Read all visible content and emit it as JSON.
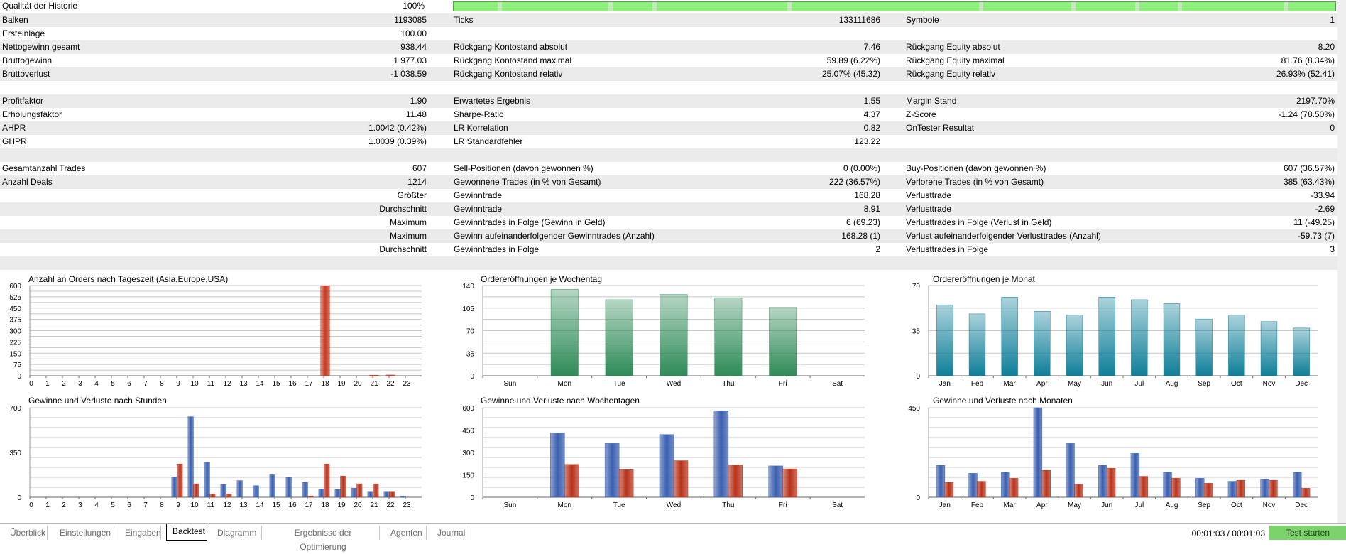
{
  "history_quality": {
    "label": "Qualität der Historie",
    "value": "100%"
  },
  "stats_rows": [
    {
      "l1": "Balken",
      "v1": "1193085",
      "l2": "Ticks",
      "v2": "133111686",
      "l3": "Symbole",
      "v3": "1",
      "alt": true
    },
    {
      "l1": "Ersteinlage",
      "v1": "100.00",
      "l2": "",
      "v2": "",
      "l3": "",
      "v3": "",
      "alt": false
    },
    {
      "l1": "Nettogewinn gesamt",
      "v1": "938.44",
      "l2": "Rückgang Kontostand absolut",
      "v2": "7.46",
      "l3": "Rückgang Equity absolut",
      "v3": "8.20",
      "alt": true
    },
    {
      "l1": "Bruttogewinn",
      "v1": "1 977.03",
      "l2": "Rückgang Kontostand maximal",
      "v2": "59.89 (6.22%)",
      "l3": "Rückgang Equity maximal",
      "v3": "81.76 (8.34%)",
      "alt": false
    },
    {
      "l1": "Bruttoverlust",
      "v1": "-1 038.59",
      "l2": "Rückgang Kontostand relativ",
      "v2": "25.07% (45.32)",
      "l3": "Rückgang Equity relativ",
      "v3": "26.93% (52.41)",
      "alt": true
    },
    {
      "l1": "",
      "v1": "",
      "l2": "",
      "v2": "",
      "l3": "",
      "v3": "",
      "alt": false
    },
    {
      "l1": "Profitfaktor",
      "v1": "1.90",
      "l2": "Erwartetes Ergebnis",
      "v2": "1.55",
      "l3": "Margin Stand",
      "v3": "2197.70%",
      "alt": true
    },
    {
      "l1": "Erholungsfaktor",
      "v1": "11.48",
      "l2": "Sharpe-Ratio",
      "v2": "4.37",
      "l3": "Z-Score",
      "v3": "-1.24 (78.50%)",
      "alt": false
    },
    {
      "l1": "AHPR",
      "v1": "1.0042 (0.42%)",
      "l2": "LR Korrelation",
      "v2": "0.82",
      "l3": "OnTester Resultat",
      "v3": "0",
      "alt": true
    },
    {
      "l1": "GHPR",
      "v1": "1.0039 (0.39%)",
      "l2": "LR Standardfehler",
      "v2": "123.22",
      "l3": "",
      "v3": "",
      "alt": false
    },
    {
      "l1": "",
      "v1": "",
      "l2": "",
      "v2": "",
      "l3": "",
      "v3": "",
      "alt": true
    },
    {
      "l1": "Gesamtanzahl Trades",
      "v1": "607",
      "l2": "Sell-Positionen (davon gewonnen %)",
      "v2": "0 (0.00%)",
      "l3": "Buy-Positionen (davon gewonnen %)",
      "v3": "607 (36.57%)",
      "alt": false
    },
    {
      "l1": "Anzahl Deals",
      "v1": "1214",
      "l2": "Gewonnene Trades (in % von Gesamt)",
      "v2": "222 (36.57%)",
      "l3": "Verlorene Trades (in % von Gesamt)",
      "v3": "385 (63.43%)",
      "alt": true
    },
    {
      "l1": "",
      "v1": "Größter",
      "l2": "Gewinntrade",
      "v2": "168.28",
      "l3": "Verlusttrade",
      "v3": "-33.94",
      "alt": false
    },
    {
      "l1": "",
      "v1": "Durchschnitt",
      "l2": "Gewinntrade",
      "v2": "8.91",
      "l3": "Verlusttrade",
      "v3": "-2.69",
      "alt": true
    },
    {
      "l1": "",
      "v1": "Maximum",
      "l2": "Gewinntrades in Folge (Gewinn in Geld)",
      "v2": "6 (69.23)",
      "l3": "Verlusttrades in Folge (Verlust in Geld)",
      "v3": "11 (-49.25)",
      "alt": false
    },
    {
      "l1": "",
      "v1": "Maximum",
      "l2": "Gewinn aufeinanderfolgender Gewinntrades (Anzahl)",
      "v2": "168.28 (1)",
      "l3": "Verlust aufeinanderfolgender Verlusttrades (Anzahl)",
      "v3": "-59.73 (7)",
      "alt": true
    },
    {
      "l1": "",
      "v1": "Durchschnitt",
      "l2": "Gewinntrades in Folge",
      "v2": "2",
      "l3": "Verlusttrades in Folge",
      "v3": "3",
      "alt": false
    },
    {
      "l1": "",
      "v1": "",
      "l2": "",
      "v2": "",
      "l3": "",
      "v3": "",
      "alt": true
    }
  ],
  "chart_data": [
    {
      "id": "orders_by_hour",
      "type": "bar",
      "title": "Anzahl an Orders nach Tageszeit (Asia,Europe,USA)",
      "categories": [
        "0",
        "1",
        "2",
        "3",
        "4",
        "5",
        "6",
        "7",
        "8",
        "9",
        "10",
        "11",
        "12",
        "13",
        "14",
        "15",
        "16",
        "17",
        "18",
        "19",
        "20",
        "21",
        "22",
        "23"
      ],
      "values": [
        0,
        0,
        0,
        0,
        0,
        0,
        0,
        0,
        0,
        0,
        0,
        0,
        0,
        0,
        0,
        0,
        0,
        0,
        598,
        0,
        0,
        4,
        5,
        0
      ],
      "yticks": [
        0,
        75,
        150,
        225,
        300,
        375,
        450,
        525,
        600
      ],
      "ylim": [
        0,
        600
      ],
      "color": "#c83a1e"
    },
    {
      "id": "orders_by_weekday",
      "type": "bar",
      "title": "Ordereröffnungen je Wochentag",
      "categories": [
        "Sun",
        "Mon",
        "Tue",
        "Wed",
        "Thu",
        "Fri",
        "Sat"
      ],
      "values": [
        0,
        134,
        118,
        126,
        121,
        106,
        0
      ],
      "yticks": [
        0,
        35,
        70,
        105,
        140
      ],
      "ylim": [
        0,
        140
      ],
      "color": "#2e8b57"
    },
    {
      "id": "orders_by_month",
      "type": "bar",
      "title": "Ordereröffnungen je Monat",
      "categories": [
        "Jan",
        "Feb",
        "Mar",
        "Apr",
        "May",
        "Jun",
        "Jul",
        "Aug",
        "Sep",
        "Oct",
        "Nov",
        "Dec"
      ],
      "values": [
        55,
        48,
        61,
        50,
        47,
        61,
        59,
        56,
        44,
        47,
        42,
        37
      ],
      "yticks": [
        0,
        35,
        70
      ],
      "ylim": [
        0,
        70
      ],
      "color": "#0f7f99"
    },
    {
      "id": "pl_by_hour",
      "type": "bar",
      "title": "Gewinne und Verluste nach Stunden",
      "categories": [
        "0",
        "1",
        "2",
        "3",
        "4",
        "5",
        "6",
        "7",
        "8",
        "9",
        "10",
        "11",
        "12",
        "13",
        "14",
        "15",
        "16",
        "17",
        "18",
        "19",
        "20",
        "21",
        "22",
        "23"
      ],
      "series": [
        {
          "values": [
            0,
            0,
            0,
            0,
            0,
            0,
            0,
            0,
            0,
            160,
            630,
            275,
            100,
            130,
            90,
            175,
            155,
            115,
            65,
            60,
            70,
            40,
            40,
            10
          ],
          "color": "#3a5fb0"
        },
        {
          "values": [
            0,
            0,
            0,
            0,
            0,
            0,
            0,
            0,
            0,
            260,
            105,
            25,
            25,
            0,
            0,
            0,
            0,
            10,
            260,
            165,
            105,
            105,
            40,
            0
          ],
          "color": "#b8321a"
        }
      ],
      "yticks": [
        0,
        350,
        700
      ],
      "ylim": [
        0,
        700
      ]
    },
    {
      "id": "pl_by_weekday",
      "type": "bar",
      "title": "Gewinne und Verluste nach Wochentagen",
      "categories": [
        "Sun",
        "Mon",
        "Tue",
        "Wed",
        "Thu",
        "Fri",
        "Sat"
      ],
      "series": [
        {
          "values": [
            0,
            430,
            360,
            420,
            580,
            210,
            0
          ],
          "color": "#3a5fb0"
        },
        {
          "values": [
            0,
            220,
            185,
            245,
            215,
            190,
            0
          ],
          "color": "#b8321a"
        }
      ],
      "yticks": [
        0,
        150,
        300,
        450,
        600
      ],
      "ylim": [
        0,
        600
      ]
    },
    {
      "id": "pl_by_month",
      "type": "bar",
      "title": "Gewinne und Verluste nach Monaten",
      "categories": [
        "Jan",
        "Feb",
        "Mar",
        "Apr",
        "May",
        "Jun",
        "Jul",
        "Aug",
        "Sep",
        "Oct",
        "Nov",
        "Dec"
      ],
      "series": [
        {
          "values": [
            160,
            120,
            125,
            460,
            270,
            160,
            220,
            125,
            95,
            80,
            90,
            125
          ],
          "color": "#3a5fb0"
        },
        {
          "values": [
            75,
            80,
            95,
            135,
            65,
            145,
            105,
            95,
            70,
            85,
            85,
            45
          ],
          "color": "#b8321a"
        }
      ],
      "yticks": [
        0,
        450
      ],
      "ylim": [
        0,
        450
      ]
    }
  ],
  "tabs": [
    "Überblick",
    "Einstellungen",
    "Eingaben",
    "Backtest",
    "Diagramm",
    "Ergebnisse der Optimierung",
    "Agenten",
    "Journal"
  ],
  "active_tab": "Backtest",
  "timer": "00:01:03 / 00:01:03",
  "start_button": "Test starten",
  "colors": {
    "row_alt": "#ebebeb",
    "quality_bar": "#8cf07a",
    "start_button": "#7cd36b"
  }
}
